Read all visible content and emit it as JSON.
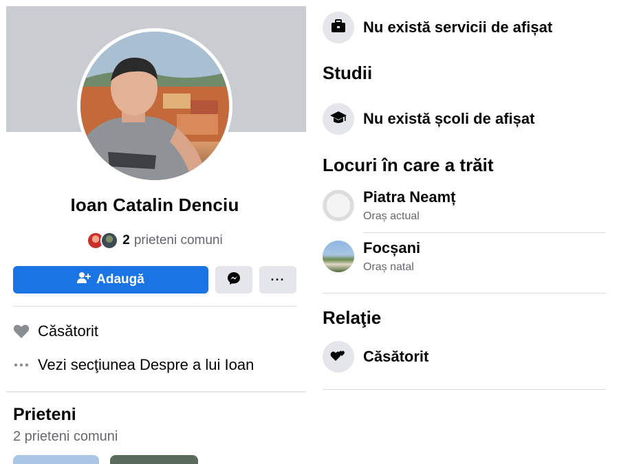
{
  "profile": {
    "name": "Ioan Catalin Denciu",
    "mutual_count": "2",
    "mutual_text": "prieteni comuni"
  },
  "actions": {
    "add_label": "Adaugă",
    "more_label": "···"
  },
  "intro": {
    "relationship": "Căsătorit",
    "see_about": "Vezi secţiunea Despre a lui Ioan"
  },
  "friends": {
    "title": "Prieteni",
    "subtitle": "2 prieteni comuni"
  },
  "about": {
    "work_empty": "Nu există servicii de afișat",
    "education_title": "Studii",
    "education_empty": "Nu există școli de afișat",
    "places_title": "Locuri în care a trăit",
    "places": [
      {
        "name": "Piatra Neamț",
        "type": "Oraș actual"
      },
      {
        "name": "Focșani",
        "type": "Oraș natal"
      }
    ],
    "relationship_title": "Relaţie",
    "relationship_value": "Căsătorit"
  },
  "icons": {
    "add_friend": "person-plus-icon",
    "messenger": "messenger-icon",
    "heart": "heart-icon",
    "more": "more-dots-icon",
    "work": "briefcase-icon",
    "education": "graduation-cap-icon",
    "relationship": "two-hearts-icon"
  },
  "colors": {
    "primary": "#1b74e4",
    "secondary_button": "#e4e6eb",
    "cover": "#c9ccd1",
    "muted_text": "#65676b"
  }
}
